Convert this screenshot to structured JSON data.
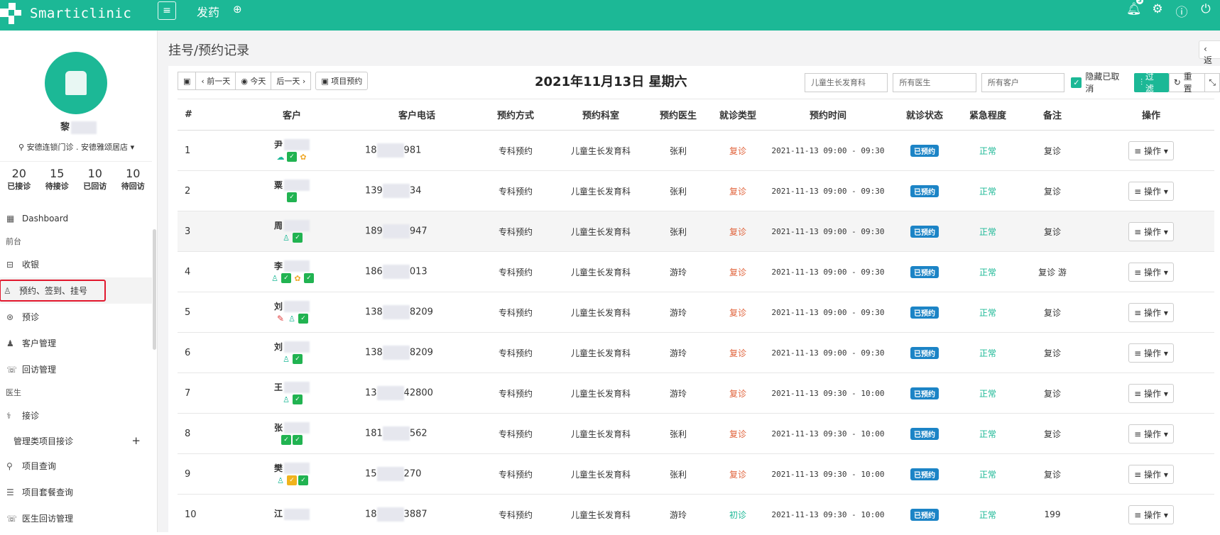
{
  "app": {
    "name": "Smarticlinic",
    "page_tab": "发药",
    "notif_count": "3"
  },
  "sidebar": {
    "user_name": "黎",
    "location": "安德连锁门诊 . 安德雅颂居店",
    "stats": [
      {
        "value": "20",
        "label": "已接诊"
      },
      {
        "value": "15",
        "label": "待接诊"
      },
      {
        "value": "10",
        "label": "已回访"
      },
      {
        "value": "10",
        "label": "待回访"
      }
    ],
    "nav": [
      {
        "type": "item",
        "label": "Dashboard",
        "icon": "dashboard-icon",
        "glyph": "▦"
      },
      {
        "type": "section",
        "label": "前台"
      },
      {
        "type": "item",
        "label": "收银",
        "icon": "cash-icon",
        "glyph": "⊟"
      },
      {
        "type": "active",
        "label": "预约、签到、挂号",
        "icon": "appointment-icon",
        "glyph": "♙"
      },
      {
        "type": "item",
        "label": "预诊",
        "icon": "prediagnosis-icon",
        "glyph": "⊛"
      },
      {
        "type": "item",
        "label": "客户管理",
        "icon": "customers-icon",
        "glyph": "♟"
      },
      {
        "type": "item",
        "label": "回访管理",
        "icon": "phone-icon",
        "glyph": "☏"
      },
      {
        "type": "section",
        "label": "医生"
      },
      {
        "type": "item",
        "label": "接诊",
        "icon": "stethoscope-icon",
        "glyph": "⚕"
      },
      {
        "type": "sub",
        "label": "管理类项目接诊",
        "icon": "plus-icon",
        "glyph": "+"
      },
      {
        "type": "item",
        "label": "项目查询",
        "icon": "search-icon",
        "glyph": "⚲"
      },
      {
        "type": "item",
        "label": "项目套餐查询",
        "icon": "package-icon",
        "glyph": "☰"
      },
      {
        "type": "item",
        "label": "医生回访管理",
        "icon": "phone-icon",
        "glyph": "☏"
      }
    ]
  },
  "main": {
    "title": "挂号/预约记录",
    "back_label": "‹ 返",
    "toolbar": {
      "prev_day": "‹ 前一天",
      "today": "◉ 今天",
      "next_day": "后一天 ›",
      "project_appt": "项目预约"
    },
    "date_title": "2021年11月13日 星期六",
    "filters": {
      "department": "儿童生长发育科",
      "doctor_placeholder": "所有医生",
      "customer_placeholder": "所有客户",
      "hide_cancelled": "隐藏已取消",
      "filter_btn": "过滤",
      "reset_btn": "重置"
    },
    "columns": [
      "#",
      "客户",
      "客户电话",
      "预约方式",
      "预约科室",
      "预约医生",
      "就诊类型",
      "预约时间",
      "就诊状态",
      "紧急程度",
      "备注",
      "操作"
    ],
    "rows": [
      {
        "no": "1",
        "name": "尹",
        "tags": [
          "cloud",
          "green",
          "flower"
        ],
        "phone_a": "18",
        "phone_b": "981",
        "method": "专科预约",
        "dept": "儿童生长发育科",
        "doctor": "张利",
        "visit_type": "复诊",
        "visit_class": "fz",
        "time": "2021-11-13 09:00 - 09:30",
        "status": "已预约",
        "urgency": "正常",
        "note": "复诊",
        "action": "≡ 操作 ▾"
      },
      {
        "no": "2",
        "name": "粟",
        "tags": [
          "green"
        ],
        "phone_a": "139",
        "phone_b": "34",
        "method": "专科预约",
        "dept": "儿童生长发育科",
        "doctor": "张利",
        "visit_type": "复诊",
        "visit_class": "fz",
        "time": "2021-11-13 09:00 - 09:30",
        "status": "已预约",
        "urgency": "正常",
        "note": "复诊",
        "action": "≡ 操作 ▾"
      },
      {
        "no": "3",
        "name": "周",
        "tags": [
          "person",
          "green"
        ],
        "phone_a": "189",
        "phone_b": "947",
        "method": "专科预约",
        "dept": "儿童生长发育科",
        "doctor": "张利",
        "visit_type": "复诊",
        "visit_class": "fz",
        "time": "2021-11-13 09:00 - 09:30",
        "status": "已预约",
        "urgency": "正常",
        "note": "复诊",
        "action": "≡ 操作 ▾"
      },
      {
        "no": "4",
        "name": "李",
        "tags": [
          "person",
          "green",
          "flower",
          "green"
        ],
        "phone_a": "186",
        "phone_b": "013",
        "method": "专科预约",
        "dept": "儿童生长发育科",
        "doctor": "游玲",
        "visit_type": "复诊",
        "visit_class": "fz",
        "time": "2021-11-13 09:00 - 09:30",
        "status": "已预约",
        "urgency": "正常",
        "note": "复诊 游",
        "action": "≡ 操作 ▾"
      },
      {
        "no": "5",
        "name": "刘",
        "tags": [
          "pen",
          "person",
          "green"
        ],
        "phone_a": "138",
        "phone_b": "8209",
        "method": "专科预约",
        "dept": "儿童生长发育科",
        "doctor": "游玲",
        "visit_type": "复诊",
        "visit_class": "fz",
        "time": "2021-11-13 09:00 - 09:30",
        "status": "已预约",
        "urgency": "正常",
        "note": "复诊",
        "action": "≡ 操作 ▾"
      },
      {
        "no": "6",
        "name": "刘",
        "tags": [
          "person",
          "green"
        ],
        "phone_a": "138",
        "phone_b": "8209",
        "method": "专科预约",
        "dept": "儿童生长发育科",
        "doctor": "游玲",
        "visit_type": "复诊",
        "visit_class": "fz",
        "time": "2021-11-13 09:00 - 09:30",
        "status": "已预约",
        "urgency": "正常",
        "note": "复诊",
        "action": "≡ 操作 ▾"
      },
      {
        "no": "7",
        "name": "王",
        "tags": [
          "person",
          "green"
        ],
        "phone_a": "13",
        "phone_b": "42800",
        "method": "专科预约",
        "dept": "儿童生长发育科",
        "doctor": "游玲",
        "visit_type": "复诊",
        "visit_class": "fz",
        "time": "2021-11-13 09:30 - 10:00",
        "status": "已预约",
        "urgency": "正常",
        "note": "复诊",
        "action": "≡ 操作 ▾"
      },
      {
        "no": "8",
        "name": "张",
        "tags": [
          "green",
          "green"
        ],
        "phone_a": "181",
        "phone_b": "562",
        "method": "专科预约",
        "dept": "儿童生长发育科",
        "doctor": "张利",
        "visit_type": "复诊",
        "visit_class": "fz",
        "time": "2021-11-13 09:30 - 10:00",
        "status": "已预约",
        "urgency": "正常",
        "note": "复诊",
        "action": "≡ 操作 ▾"
      },
      {
        "no": "9",
        "name": "樊",
        "tags": [
          "person",
          "amber",
          "green"
        ],
        "phone_a": "15",
        "phone_b": "270",
        "method": "专科预约",
        "dept": "儿童生长发育科",
        "doctor": "张利",
        "visit_type": "复诊",
        "visit_class": "fz",
        "time": "2021-11-13 09:30 - 10:00",
        "status": "已预约",
        "urgency": "正常",
        "note": "复诊",
        "action": "≡ 操作 ▾"
      },
      {
        "no": "10",
        "name": "江",
        "tags": [],
        "phone_a": "18",
        "phone_b": "3887",
        "method": "专科预约",
        "dept": "儿童生长发育科",
        "doctor": "游玲",
        "visit_type": "初诊",
        "visit_class": "cz",
        "time": "2021-11-13 09:30 - 10:00",
        "status": "已预约",
        "urgency": "正常",
        "note": "199",
        "action": "≡ 操作 ▾"
      }
    ]
  },
  "colors": {
    "brand": "#1cb896",
    "status_blue": "#1c84c6",
    "revisit": "#e0623a",
    "highlight_border": "#e2182e"
  }
}
